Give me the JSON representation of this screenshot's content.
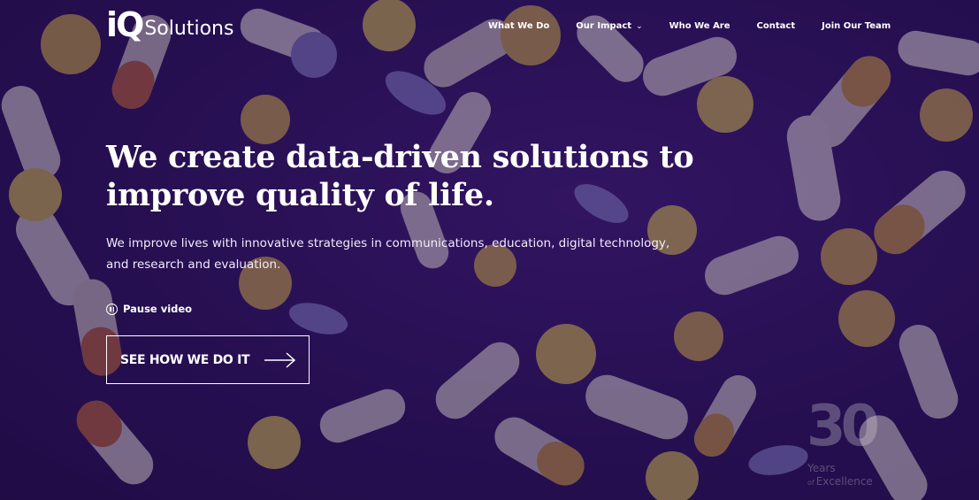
{
  "header": {
    "logo": {
      "mark": "iQ",
      "text": "Solutions"
    },
    "nav": [
      {
        "label": "What We Do"
      },
      {
        "label": "Our Impact",
        "icon": "chevron-down-icon"
      },
      {
        "label": "Who We Are"
      },
      {
        "label": "Contact"
      },
      {
        "label": "Join Our Team"
      }
    ]
  },
  "hero": {
    "headline_line1": "We create data-driven solutions to",
    "headline_line2": "improve quality of life.",
    "subtext_line1": "We improve lives with innovative strategies in communications, education, digital technology,",
    "subtext_line2": "and research and evaluation.",
    "pause_label": "Pause video",
    "cta_label": "SEE HOW WE DO IT"
  },
  "badge": {
    "number": "30",
    "line1": "Years",
    "line2_prefix": "of",
    "line2": "Excellence"
  },
  "colors": {
    "background": "#2a0f57",
    "text": "#ffffff"
  }
}
